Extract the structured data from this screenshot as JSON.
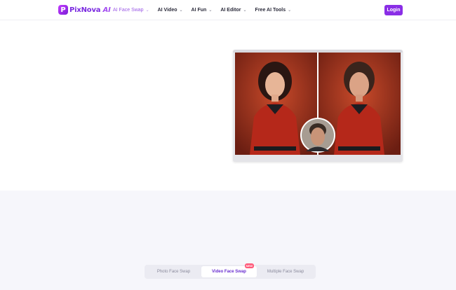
{
  "brand": {
    "name": "PixNova",
    "suffix": "AI",
    "mark": "P"
  },
  "nav": {
    "items": [
      {
        "label": "AI Face Swap",
        "active": true
      },
      {
        "label": "AI Video",
        "active": false
      },
      {
        "label": "AI Fun",
        "active": false
      },
      {
        "label": "AI Editor",
        "active": false
      },
      {
        "label": "Free AI Tools",
        "active": false
      }
    ],
    "chevron": "⌄"
  },
  "header": {
    "login_label": "Login"
  },
  "colors": {
    "accent": "#8a2ee6",
    "active_nav": "#9b59e6",
    "badge": "#ff5a7a",
    "section_bg": "#f6f6fb"
  },
  "hero": {
    "left_image": "woman-portrait",
    "right_image": "face-swapped-portrait",
    "source_face": "man-face-thumbnail"
  },
  "tabs": {
    "items": [
      {
        "label": "Photo Face Swap",
        "active": false
      },
      {
        "label": "Video Face Swap",
        "active": true,
        "badge": "NEW"
      },
      {
        "label": "Multiple Face Swap",
        "active": false
      }
    ]
  }
}
